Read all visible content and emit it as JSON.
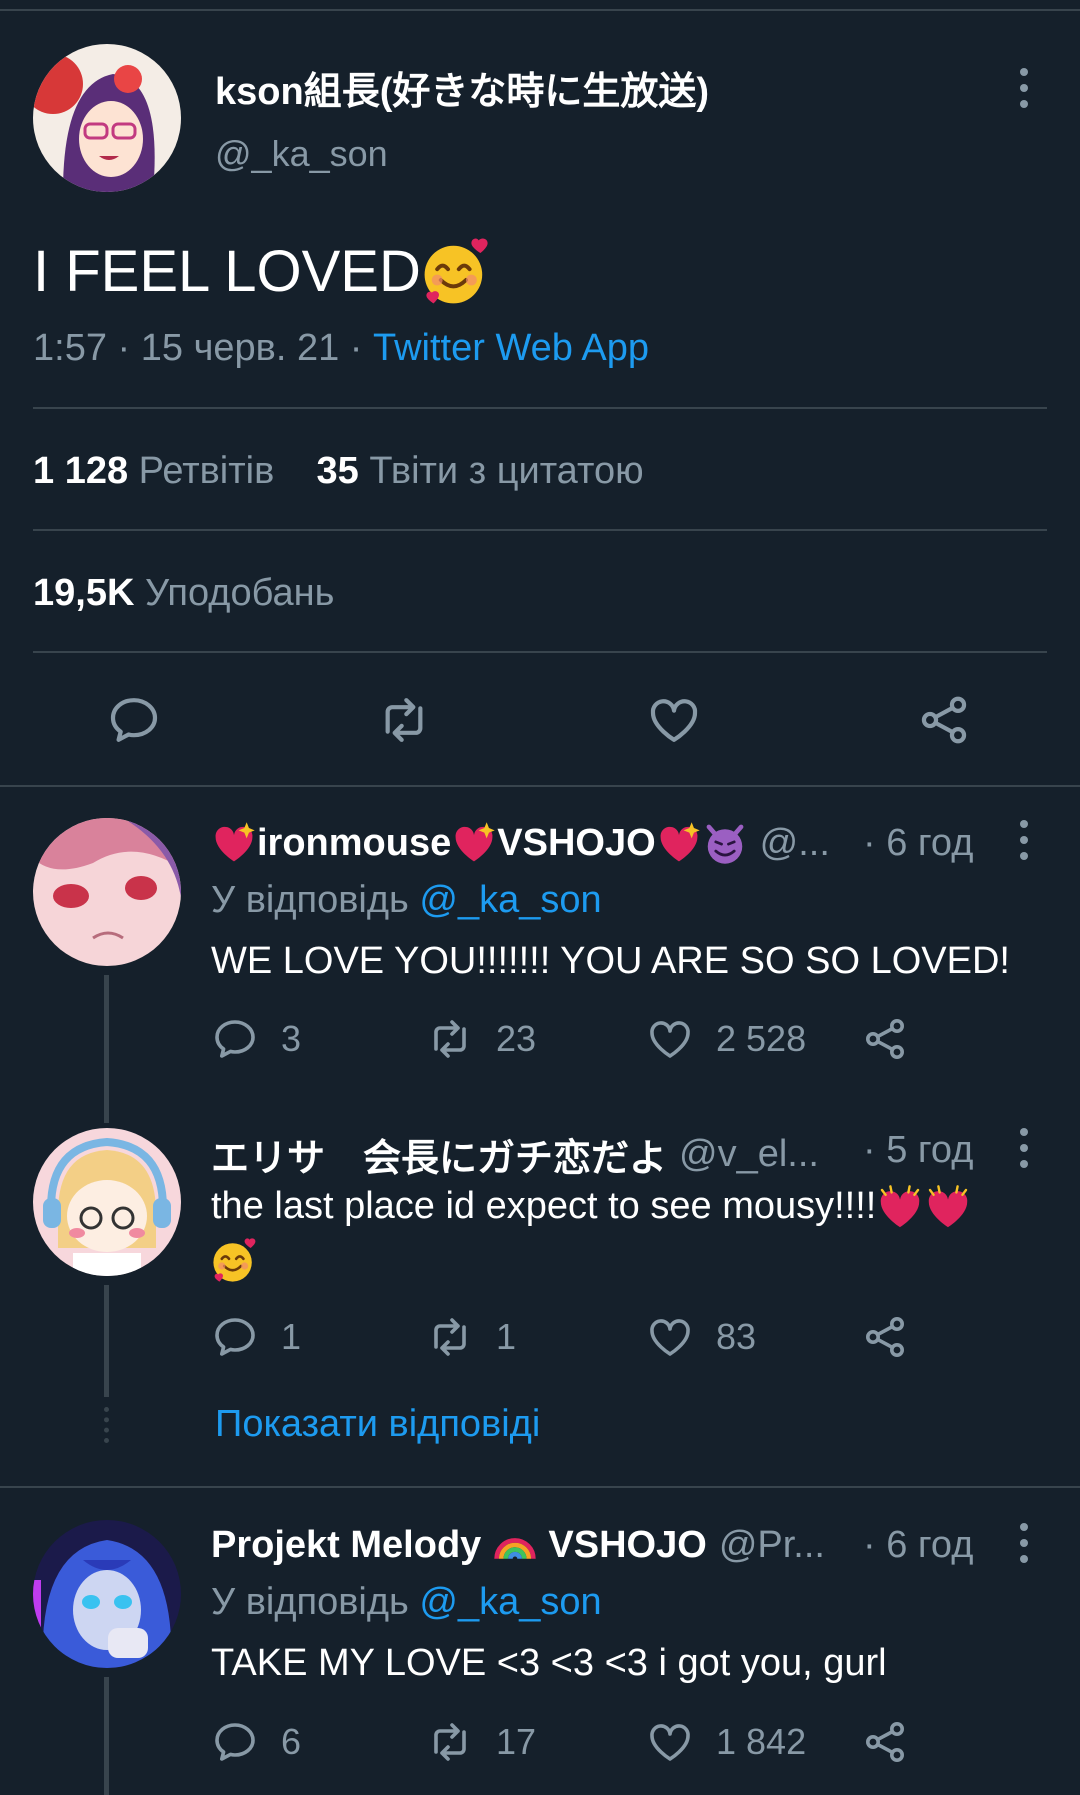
{
  "main_tweet": {
    "author_name": "kson組長(好きな時に生放送)",
    "handle": "@_ka_son",
    "text": "I FEEL LOVED",
    "time": "1:57",
    "date": "15 черв. 21",
    "source": "Twitter Web App",
    "retweets_count": "1 128",
    "retweets_label": "Ретвітів",
    "quotes_count": "35",
    "quotes_label": "Твіти з цитатою",
    "likes_count": "19,5K",
    "likes_label": "Уподобань"
  },
  "replies": [
    {
      "name": "ironmouse",
      "name_suffix": "VSHOJO",
      "handle": "@...",
      "time": "· 6 год",
      "reply_to_label": "У відповідь",
      "reply_to_handle": "@_ka_son",
      "text": "WE LOVE YOU!!!!!!! YOU ARE SO SO LOVED!",
      "replies": "3",
      "retweets": "23",
      "likes": "2 528"
    },
    {
      "name": "エリサ　会長にガチ恋だよ",
      "handle": "@v_el...",
      "time": "· 5 год",
      "text": "the last place id expect to see mousy!!!!",
      "replies": "1",
      "retweets": "1",
      "likes": "83"
    },
    {
      "name": "Projekt Melody",
      "name_suffix": "VSHOJO",
      "handle": "@Pr...",
      "time": "· 6 год",
      "reply_to_label": "У відповідь",
      "reply_to_handle": "@_ka_son",
      "text": "TAKE MY LOVE <3 <3 <3 i got you, gurl",
      "replies": "6",
      "retweets": "17",
      "likes": "1 842"
    }
  ],
  "show_replies_label": "Показати відповіді",
  "icons": [
    "reply-icon",
    "retweet-icon",
    "like-icon",
    "share-icon",
    "more-icon"
  ],
  "colors": {
    "background": "#15202b",
    "accent": "#1d9bf0",
    "secondary": "#8899a6",
    "divider": "#38444d"
  }
}
